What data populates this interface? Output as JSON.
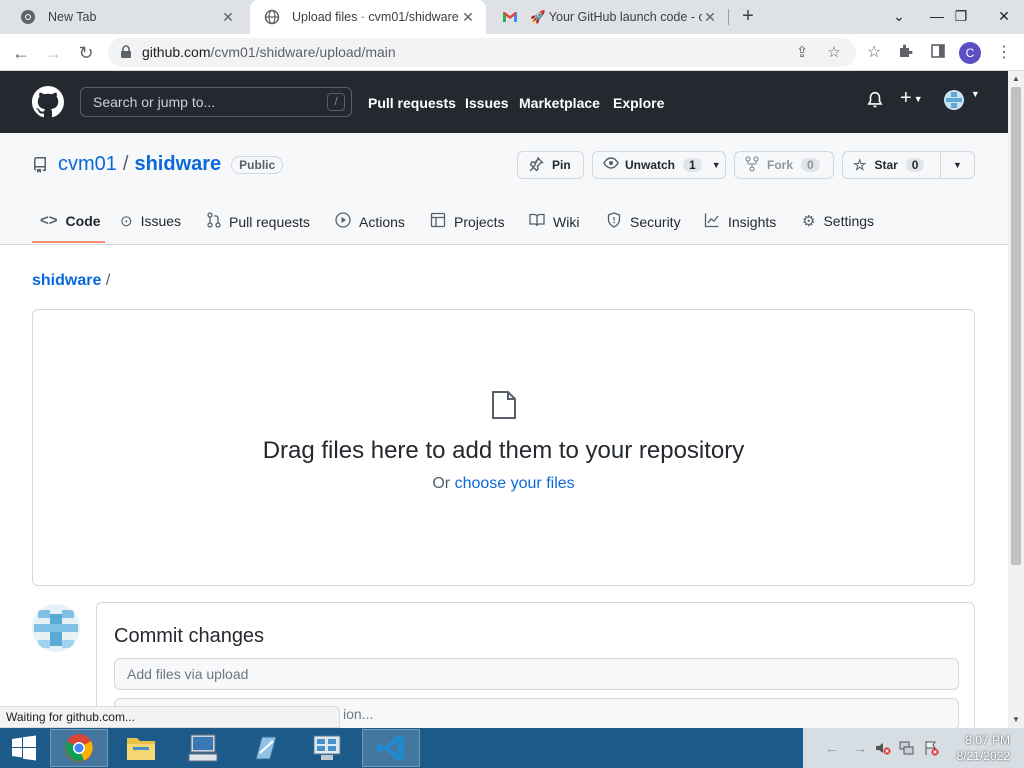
{
  "browser": {
    "tabs": [
      {
        "title": "New Tab",
        "icon": "chrome-icon",
        "active": false
      },
      {
        "title": "Upload files · cvm01/shidware",
        "icon": "globe-icon",
        "active": true
      },
      {
        "title": "🚀 Your GitHub launch code - col",
        "icon": "gmail-icon",
        "active": false
      }
    ],
    "url_host": "github.com",
    "url_path": "/cvm01/shidware/upload/main",
    "profile_initial": "C"
  },
  "gh_header": {
    "search_placeholder": "Search or jump to...",
    "search_key": "/",
    "nav": [
      "Pull requests",
      "Issues",
      "Marketplace",
      "Explore"
    ]
  },
  "repo": {
    "owner": "cvm01",
    "separator": "/",
    "name": "shidware",
    "visibility": "Public",
    "pin_label": "Pin",
    "unwatch_label": "Unwatch",
    "watch_count": "1",
    "fork_label": "Fork",
    "fork_count": "0",
    "star_label": "Star",
    "star_count": "0",
    "tabs": [
      {
        "label": "Code",
        "icon": "code-icon"
      },
      {
        "label": "Issues",
        "icon": "issue-icon"
      },
      {
        "label": "Pull requests",
        "icon": "pull-request-icon"
      },
      {
        "label": "Actions",
        "icon": "play-icon"
      },
      {
        "label": "Projects",
        "icon": "table-icon"
      },
      {
        "label": "Wiki",
        "icon": "book-icon"
      },
      {
        "label": "Security",
        "icon": "shield-icon"
      },
      {
        "label": "Insights",
        "icon": "graph-icon"
      },
      {
        "label": "Settings",
        "icon": "gear-icon"
      }
    ]
  },
  "upload": {
    "breadcrumb_repo": "shidware",
    "breadcrumb_sep": "/",
    "drop_title": "Drag files here to add them to your repository",
    "drop_sub_prefix": "Or ",
    "drop_sub_link": "choose your files"
  },
  "commit": {
    "title": "Commit changes",
    "summary_placeholder": "Add files via upload",
    "description_placeholder": "ion..."
  },
  "status_text": "Waiting for github.com...",
  "taskbar": {
    "time": "8:07 PM",
    "date": "8/21/2022"
  }
}
